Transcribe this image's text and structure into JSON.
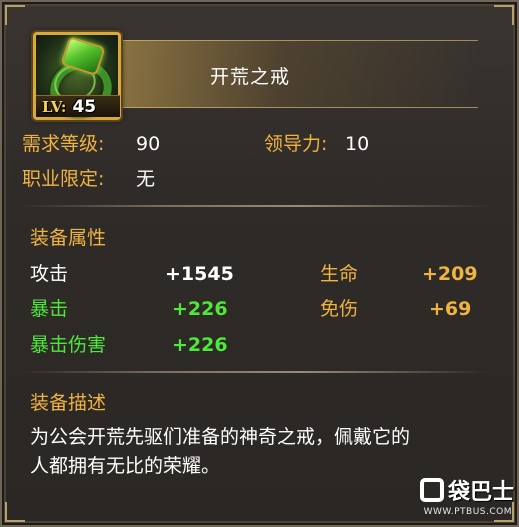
{
  "item": {
    "name": "开荒之戒",
    "level_label": "LV:",
    "level_value": "45"
  },
  "requirements": {
    "level_label": "需求等级:",
    "level_value": "90",
    "leadership_label": "领导力:",
    "leadership_value": "10",
    "class_label": "职业限定:",
    "class_value": "无"
  },
  "attributes": {
    "heading": "装备属性",
    "rows": [
      {
        "label": "攻击",
        "value": "+1545"
      },
      {
        "label": "生命",
        "value": "+209"
      },
      {
        "label": "暴击",
        "value": "+226"
      },
      {
        "label": "免伤",
        "value": "+69"
      },
      {
        "label": "暴击伤害",
        "value": "+226"
      }
    ]
  },
  "description": {
    "heading": "装备描述",
    "line1": "为公会开荒先驱们准备的神奇之戒，佩戴它的",
    "line2": "人都拥有无比的荣耀。"
  },
  "watermark": {
    "logo_text": "袋巴士",
    "url": "WWW.PTBUS.COM"
  },
  "colors": {
    "orange_text": "#f0b340",
    "green_text": "#4ee83a",
    "frame_gold": "#d9a93a",
    "background": "#2f2b28"
  },
  "icons": {
    "item_icon": "green-gem-ring-icon"
  }
}
